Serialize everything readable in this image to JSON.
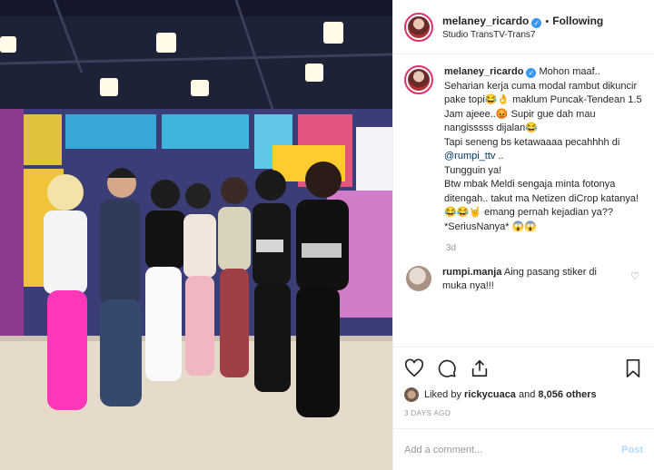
{
  "header": {
    "username": "melaney_ricardo",
    "verified_mark": "✓",
    "separator": "•",
    "follow_status": "Following",
    "location": "Studio TransTV-Trans7",
    "more_icon": "ellipsis-icon"
  },
  "caption": {
    "username": "melaney_ricardo",
    "part1": "Mohon maaf.. Seharian kerja cuma modal rambut dikuncir pake topi😂👌 maklum Puncak-Tendean 1.5 Jam ajeee..😡 Supir gue dah mau nangisssss dijalan😂",
    "part2": "Tapi seneng bs ketawaaaa pecahhhh di",
    "mention": "@rumpi_ttv",
    "part3": "..",
    "part4": "Tungguin ya!",
    "part5": "Btw mbak Meldi sengaja minta fotonya ditengah.. takut ma Netizen diCrop katanya!😂😂🤘 emang pernah kejadian ya??*SeriusNanya* 😱😱",
    "time_ago": "3d"
  },
  "reply": {
    "username": "rumpi.manja",
    "text": "Aing pasang stiker di muka nya!!!",
    "like_icon": "heart-outline-icon",
    "like_glyph": "♡"
  },
  "actions": {
    "like_icon": "heart-icon",
    "comment_icon": "comment-icon",
    "share_icon": "share-icon",
    "bookmark_icon": "bookmark-icon"
  },
  "likes": {
    "prefix": "Liked by",
    "user": "rickycuaca",
    "middle": "and",
    "count": "8,056 others"
  },
  "date": "3 DAYS AGO",
  "add_comment": {
    "placeholder": "Add a comment...",
    "post_label": "Post"
  },
  "colors": {
    "verified": "#3897f0",
    "story_ring": "#e1306c",
    "post_disabled": "#b3dbff",
    "muted": "#999999"
  }
}
